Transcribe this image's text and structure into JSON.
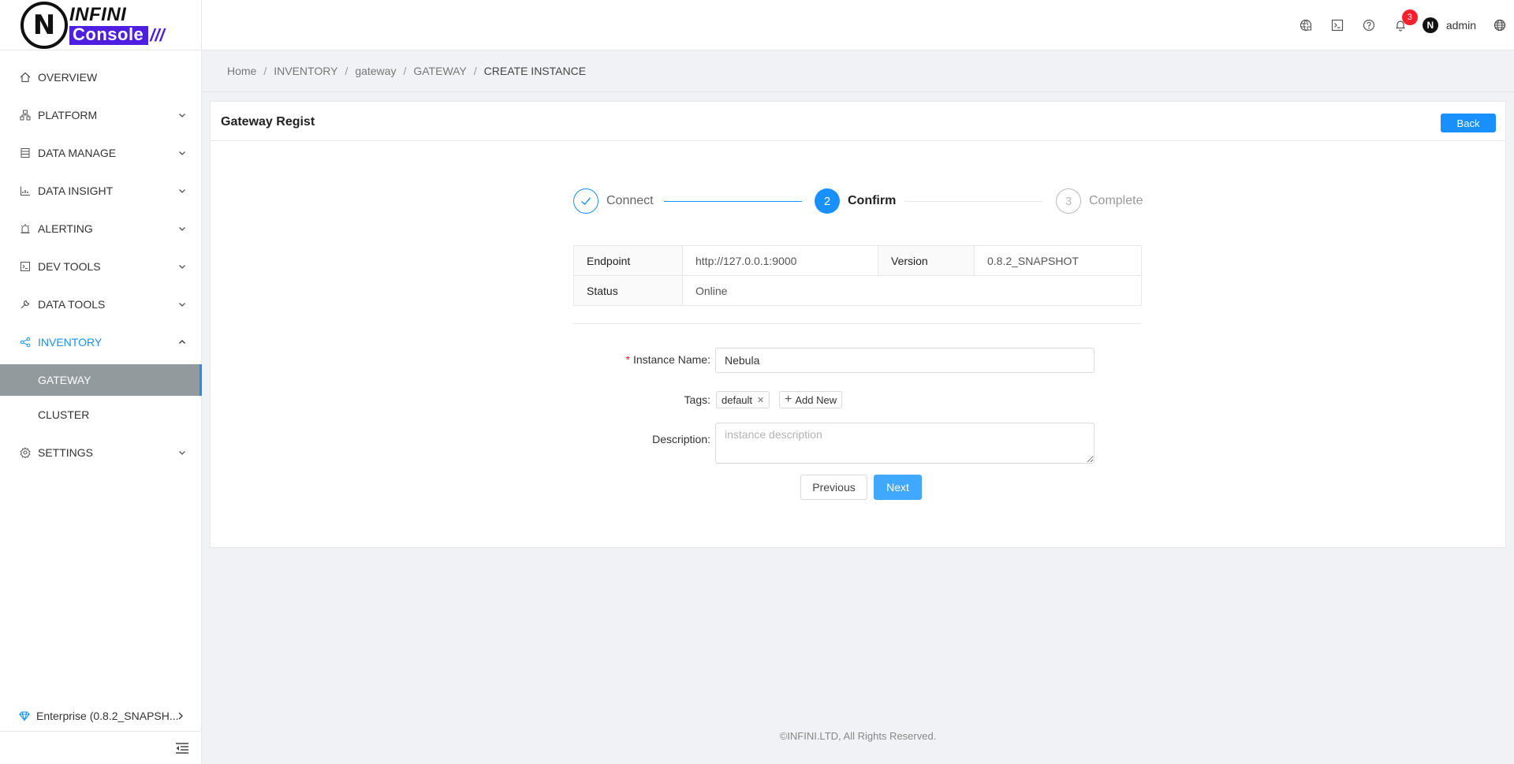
{
  "logo": {
    "mark": "N",
    "line1": "INFINI",
    "line2": "Console",
    "stripes": "///"
  },
  "header": {
    "notification_count": "3",
    "username": "admin",
    "avatar_letter": "N"
  },
  "sidebar": {
    "items": [
      {
        "label": "OVERVIEW",
        "icon": "home-icon"
      },
      {
        "label": "PLATFORM",
        "icon": "cluster-icon"
      },
      {
        "label": "DATA MANAGE",
        "icon": "database-icon"
      },
      {
        "label": "DATA INSIGHT",
        "icon": "chart-icon"
      },
      {
        "label": "ALERTING",
        "icon": "alarm-icon"
      },
      {
        "label": "DEV TOOLS",
        "icon": "code-icon"
      },
      {
        "label": "DATA TOOLS",
        "icon": "tool-icon"
      },
      {
        "label": "INVENTORY",
        "icon": "share-icon"
      },
      {
        "label": "SETTINGS",
        "icon": "gear-icon"
      }
    ],
    "inventory_sub": [
      "GATEWAY",
      "CLUSTER"
    ],
    "enterprise": "Enterprise (0.8.2_SNAPSH..."
  },
  "breadcrumb": [
    "Home",
    "INVENTORY",
    "gateway",
    "GATEWAY",
    "CREATE INSTANCE"
  ],
  "card": {
    "title": "Gateway Regist",
    "back_label": "Back"
  },
  "steps": [
    {
      "label": "Connect",
      "num": ""
    },
    {
      "label": "Confirm",
      "num": "2"
    },
    {
      "label": "Complete",
      "num": "3"
    }
  ],
  "info": {
    "endpoint_label": "Endpoint",
    "endpoint_value": "http://127.0.0.1:9000",
    "version_label": "Version",
    "version_value": "0.8.2_SNAPSHOT",
    "status_label": "Status",
    "status_value": "Online"
  },
  "form": {
    "name_label": "Instance Name:",
    "name_value": "Nebula",
    "tags_label": "Tags:",
    "tags": [
      "default"
    ],
    "add_tag_label": "Add New",
    "desc_label": "Description:",
    "desc_placeholder": "instance description",
    "prev_label": "Previous",
    "next_label": "Next"
  },
  "footer": "©INFINI.LTD, All Rights Reserved.",
  "colors": {
    "primary": "#1890ff",
    "selected_bg": "#939a9e",
    "brand": "#4e1fe0"
  }
}
